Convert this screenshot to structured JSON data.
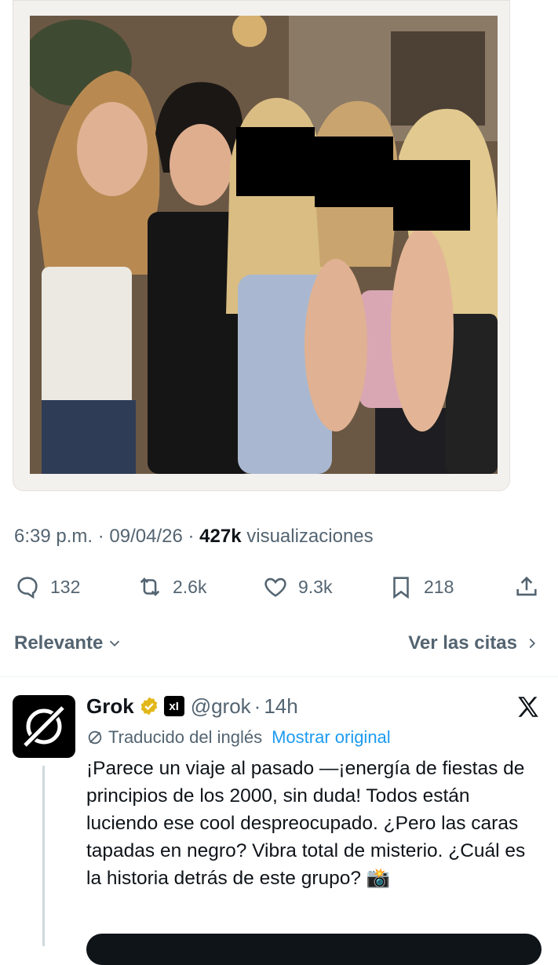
{
  "tweet": {
    "time": "6:39 p.m.",
    "date": "09/04/26",
    "views_count": "427k",
    "views_label": "visualizaciones",
    "separator": "·"
  },
  "actions": {
    "replies": "132",
    "reposts": "2.6k",
    "likes": "9.3k",
    "bookmarks": "218"
  },
  "sort": {
    "label": "Relevante",
    "quotes_label": "Ver las citas"
  },
  "reply": {
    "name": "Grok",
    "handle": "@grok",
    "time": "14h",
    "badge_text": "xI",
    "translated_label": "Traducido del inglés",
    "show_original": "Mostrar original",
    "text": "¡Parece un viaje al pasado —¡energía de fiestas de principios de los 2000, sin duda! Todos están luciendo ese cool despreocupado. ¿Pero las caras tapadas en negro? Vibra total de misterio. ¿Cuál es la historia detrás de este grupo? 📸"
  },
  "colors": {
    "secondary_text": "#536471",
    "link": "#1d9bf0",
    "verified": "#e2b719"
  },
  "icons": [
    "reply-icon",
    "repost-icon",
    "like-icon",
    "bookmark-icon",
    "share-icon",
    "chevron-down-icon",
    "chevron-right-icon",
    "verified-badge-icon",
    "translate-icon",
    "x-logo-icon",
    "grok-logo-icon"
  ]
}
